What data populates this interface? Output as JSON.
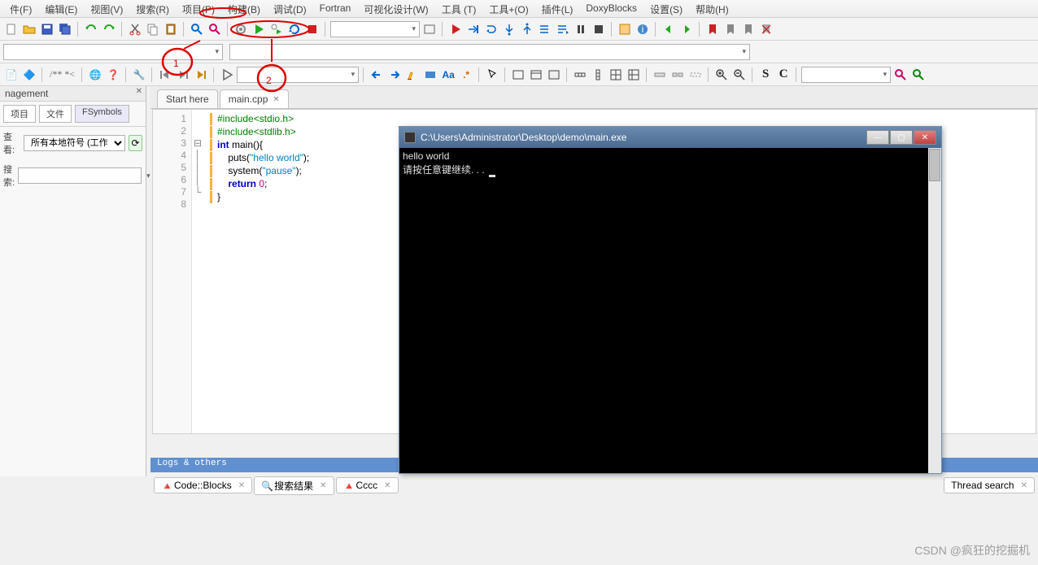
{
  "menu": {
    "items": [
      "件(F)",
      "编辑(E)",
      "视图(V)",
      "搜索(R)",
      "项目(P)",
      "构建(B)",
      "调试(D)",
      "Fortran",
      "可视化设计(W)",
      "工具 (T)",
      "工具+(O)",
      "插件(L)",
      "DoxyBlocks",
      "设置(S)",
      "帮助(H)"
    ]
  },
  "management": {
    "title": "nagement",
    "tabs": [
      "项目",
      "文件",
      "FSymbols"
    ],
    "look_label": "查看:",
    "look_value": "所有本地符号 (工作",
    "search_label": "搜索:"
  },
  "editor": {
    "tabs": [
      {
        "label": "Start here",
        "active": false
      },
      {
        "label": "main.cpp",
        "active": true
      }
    ],
    "line_numbers": [
      "1",
      "2",
      "3",
      "4",
      "5",
      "6",
      "7",
      "8"
    ],
    "code": {
      "l1_pre": "#include",
      "l1_rest": "<stdio.h>",
      "l2_pre": "#include",
      "l2_rest": "<stdlib.h>",
      "l3_kw": "int",
      "l3_rest": " main(){",
      "l4a": "    puts(",
      "l4s": "\"hello world\"",
      "l4b": ");",
      "l5a": "    system(",
      "l5s": "\"pause\"",
      "l5b": ");",
      "l6a": "    ",
      "l6kw": "return",
      "l6b": " ",
      "l6n": "0",
      "l6c": ";",
      "l7": "}"
    }
  },
  "console": {
    "title": "C:\\Users\\Administrator\\Desktop\\demo\\main.exe",
    "line1": "hello world",
    "line2": "请按任意键继续. . . "
  },
  "logs": {
    "header": "Logs & others"
  },
  "bottom_tabs": [
    {
      "label": "Code::Blocks"
    },
    {
      "label": "搜索结果"
    },
    {
      "label": "Cccc"
    },
    {
      "label": "Thread search"
    }
  ],
  "watermark": "CSDN @疯狂的挖掘机",
  "toolbar_text": {
    "s": "S",
    "c": "C",
    "abc": "/**  *<"
  }
}
